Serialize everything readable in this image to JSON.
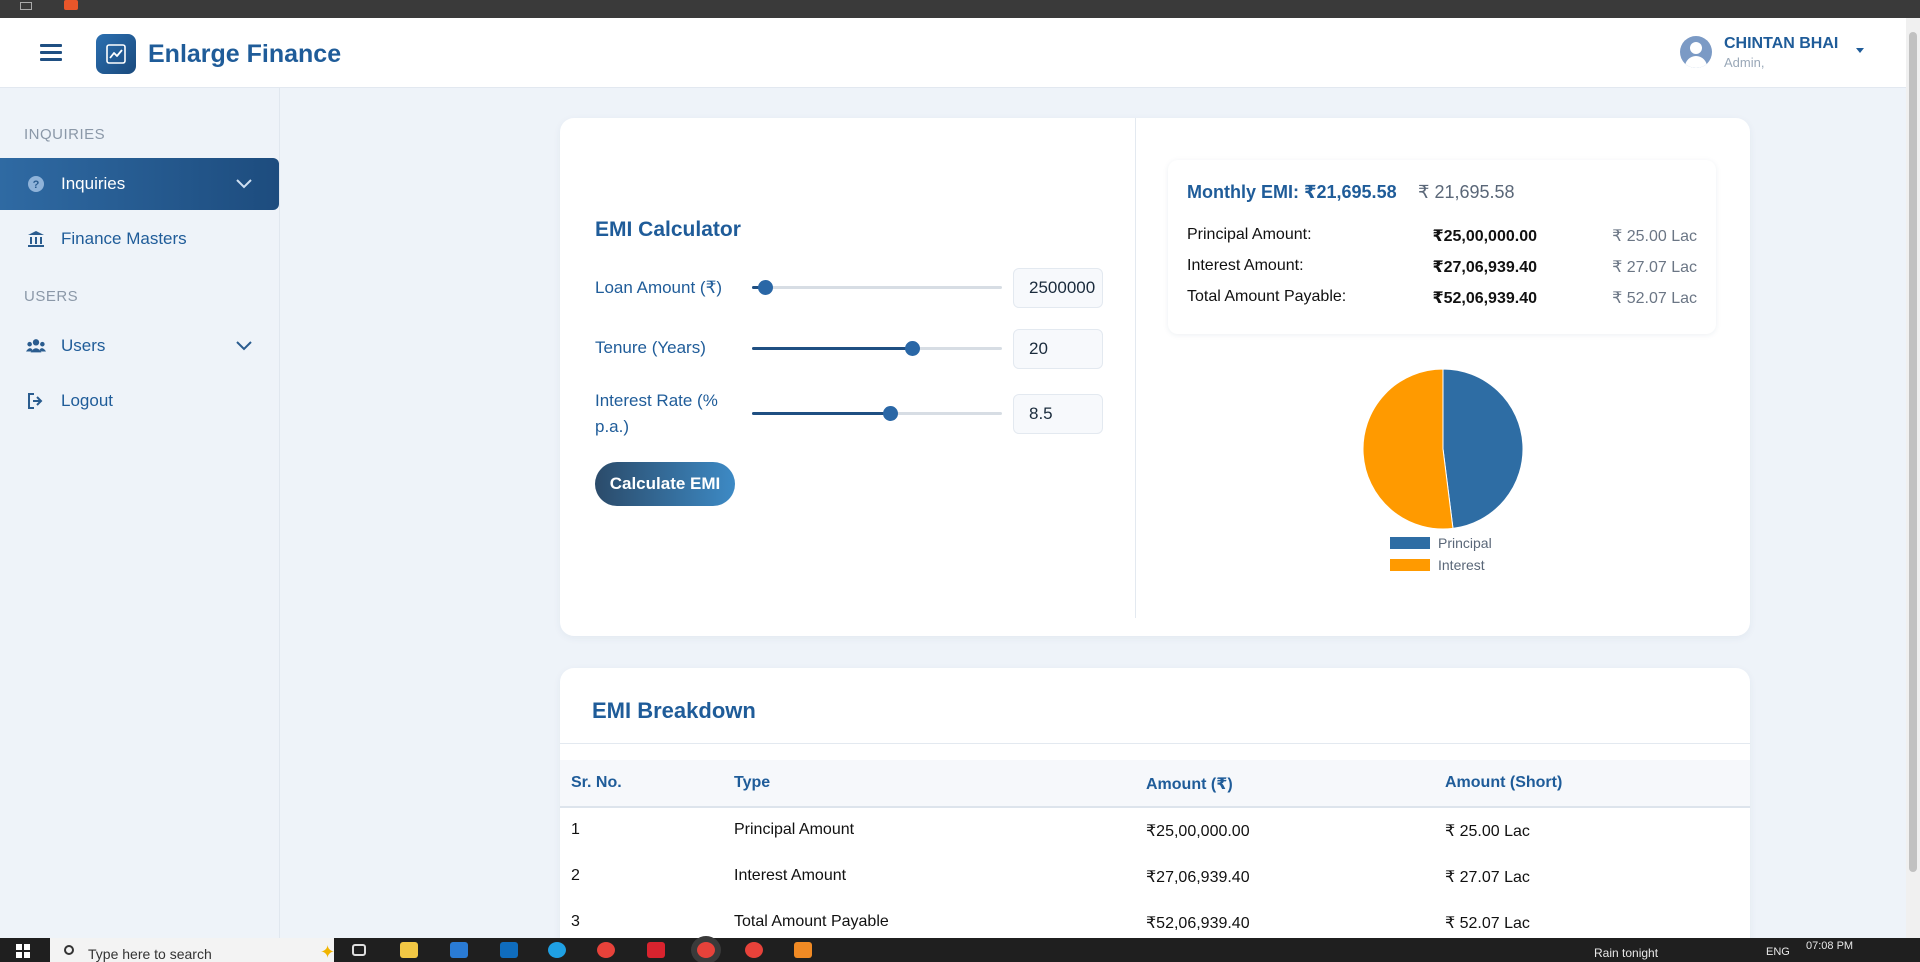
{
  "app": {
    "brand": "Enlarge Finance",
    "user_name": "CHINTAN BHAI",
    "user_role": "Admin,"
  },
  "sidebar": {
    "sections": [
      {
        "title": "INQUIRIES"
      },
      {
        "title": "USERS"
      }
    ],
    "items": [
      {
        "label": "Inquiries",
        "icon": "question-circle-icon",
        "active": true,
        "has_chevron": true
      },
      {
        "label": "Finance Masters",
        "icon": "bank-icon",
        "active": false,
        "has_chevron": false
      },
      {
        "label": "Users",
        "icon": "users-icon",
        "active": false,
        "has_chevron": true
      },
      {
        "label": "Logout",
        "icon": "logout-icon",
        "active": false,
        "has_chevron": false
      }
    ]
  },
  "calculator": {
    "title": "EMI Calculator",
    "fields": [
      {
        "label": "Loan Amount (₹)",
        "value": "2500000",
        "slider_percent": 5
      },
      {
        "label": "Tenure (Years)",
        "value": "20",
        "slider_percent": 64
      },
      {
        "label": "Interest Rate (% p.a.)",
        "value": "8.5",
        "slider_percent": 55
      }
    ],
    "button_label": "Calculate EMI"
  },
  "summary": {
    "monthly_emi_label": "Monthly EMI: ₹21,695.58",
    "monthly_emi_short": "₹ 21,695.58",
    "rows": [
      {
        "label": "Principal Amount:",
        "value": "₹25,00,000.00",
        "short": "₹ 25.00 Lac"
      },
      {
        "label": "Interest Amount:",
        "value": "₹27,06,939.40",
        "short": "₹ 27.07 Lac"
      },
      {
        "label": "Total Amount Payable:",
        "value": "₹52,06,939.40",
        "short": "₹ 52.07 Lac"
      }
    ]
  },
  "chart_data": {
    "type": "pie",
    "categories": [
      "Principal",
      "Interest"
    ],
    "values": [
      2500000.0,
      2706939.4
    ],
    "colors": [
      "#2e6da4",
      "#ff9a00"
    ],
    "legend": "bottom"
  },
  "breakdown": {
    "title": "EMI Breakdown",
    "headers": [
      "Sr. No.",
      "Type",
      "Amount (₹)",
      "Amount (Short)"
    ],
    "rows": [
      [
        "1",
        "Principal Amount",
        "₹25,00,000.00",
        "₹ 25.00 Lac"
      ],
      [
        "2",
        "Interest Amount",
        "₹27,06,939.40",
        "₹ 27.07 Lac"
      ],
      [
        "3",
        "Total Amount Payable",
        "₹52,06,939.40",
        "₹ 52.07 Lac"
      ]
    ]
  },
  "taskbar": {
    "search_placeholder": "Type here to search",
    "weather": "Rain tonight",
    "language": "ENG",
    "time": "07:08 PM"
  },
  "colors": {
    "primary": "#1f5c99",
    "principal": "#2e6da4",
    "interest": "#ff9a00"
  }
}
